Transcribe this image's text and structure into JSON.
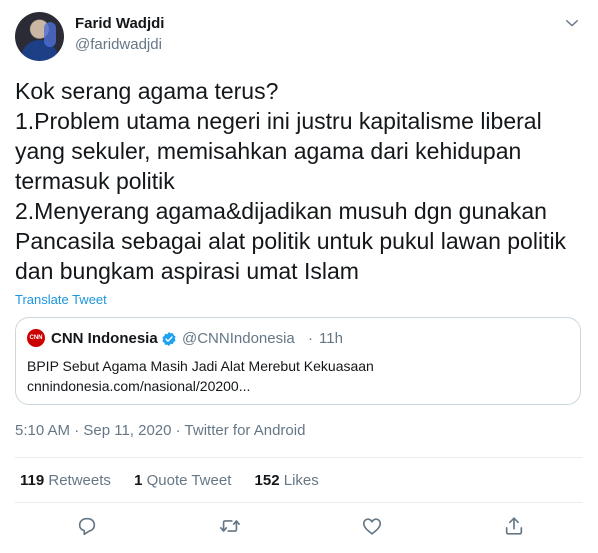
{
  "author": {
    "name": "Farid Wadjdi",
    "handle": "@faridwadjdi"
  },
  "tweet": {
    "text": "Kok serang agama terus?\n1.Problem utama negeri ini justru kapitalisme liberal yang sekuler, memisahkan agama dari kehidupan termasuk politik\n2.Menyerang agama&dijadikan musuh dgn gunakan Pancasila sebagai alat politik untuk pukul lawan politik dan bungkam aspirasi umat Islam",
    "translate_label": "Translate Tweet"
  },
  "quote": {
    "logo_text": "CNN",
    "name": "CNN Indonesia",
    "handle": "@CNNIndonesia",
    "separator": "·",
    "time": "11h",
    "text": "BPIP Sebut Agama Masih Jadi Alat Merebut Kekuasaan cnnindonesia.com/nasional/20200..."
  },
  "meta": {
    "timestamp": "5:10 AM · Sep 11, 2020 · Twitter for Android"
  },
  "stats": {
    "retweets_count": "119",
    "retweets_label": "Retweets",
    "quotes_count": "1",
    "quotes_label": "Quote Tweet",
    "likes_count": "152",
    "likes_label": "Likes"
  },
  "icons": {
    "caret": "chevron-down-icon",
    "verified": "verified-badge-icon",
    "reply": "reply-icon",
    "retweet": "retweet-icon",
    "like": "heart-icon",
    "share": "share-icon"
  },
  "colors": {
    "link": "#1b95e0",
    "secondary": "#657786",
    "verified": "#1da1f2",
    "cnn_red": "#cc0000"
  }
}
